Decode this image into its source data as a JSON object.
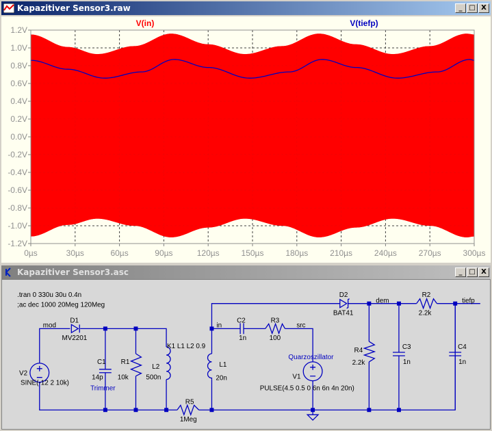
{
  "waveform_window": {
    "title": "Kapazitiver Sensor3.raw",
    "controls": {
      "minimize": "_",
      "maximize": "□",
      "close": "X"
    }
  },
  "schematic_window": {
    "title": "Kapazitiver Sensor3.asc",
    "controls": {
      "minimize": "_",
      "maximize": "□",
      "close": "X"
    }
  },
  "chart_data": {
    "type": "line",
    "xlabel": "",
    "ylabel": "",
    "xlim": [
      0,
      300
    ],
    "ylim": [
      -1.2,
      1.2
    ],
    "x_ticks": [
      "0µs",
      "30µs",
      "60µs",
      "90µs",
      "120µs",
      "150µs",
      "180µs",
      "210µs",
      "240µs",
      "270µs",
      "300µs"
    ],
    "y_ticks": [
      "1.2V",
      "1.0V",
      "0.8V",
      "0.6V",
      "0.4V",
      "0.2V",
      "0.0V",
      "-0.2V",
      "-0.4V",
      "-0.6V",
      "-0.8V",
      "-1.0V",
      "-1.2V"
    ],
    "grid": true,
    "series": [
      {
        "name": "V(in)",
        "color": "#ff0000",
        "style": "filled high-frequency carrier envelope",
        "x": [
          0,
          25,
          45,
          70,
          95,
          120,
          145,
          170,
          195,
          220,
          245,
          270,
          295,
          300
        ],
        "upper": [
          1.15,
          1.01,
          0.93,
          1.02,
          1.16,
          1.04,
          0.93,
          1.02,
          1.16,
          1.04,
          0.93,
          1.02,
          1.16,
          1.15
        ],
        "lower": [
          -1.12,
          -0.99,
          -0.92,
          -1.0,
          -1.13,
          -1.02,
          -0.92,
          -1.0,
          -1.13,
          -1.02,
          -0.92,
          -1.0,
          -1.13,
          -1.12
        ]
      },
      {
        "name": "V(tiefp)",
        "color": "#0000c0",
        "x": [
          0,
          25,
          50,
          75,
          97,
          120,
          148,
          175,
          197,
          220,
          248,
          275,
          297,
          300
        ],
        "values": [
          0.86,
          0.76,
          0.66,
          0.73,
          0.87,
          0.78,
          0.66,
          0.73,
          0.87,
          0.78,
          0.66,
          0.73,
          0.87,
          0.86
        ]
      }
    ]
  },
  "schematic": {
    "directives": [
      ".tran 0 330u 30u 0.4n",
      ";ac dec 1000 20Meg 120Meg"
    ],
    "nets": {
      "mod": "mod",
      "in": "in",
      "src": "src",
      "dem": "dem",
      "tiefp": "tiefp"
    },
    "components": {
      "D1": {
        "name": "D1",
        "value": "MV2201"
      },
      "V2": {
        "name": "V2",
        "value": "SINE(-12 2 10k)"
      },
      "C1": {
        "name": "C1",
        "value": "14p",
        "comment": "Trimmer"
      },
      "R1": {
        "name": "R1",
        "value": "10k"
      },
      "L2": {
        "name": "L2",
        "value": "500n"
      },
      "K1": {
        "text": "K1 L1 L2 0.9"
      },
      "R5": {
        "name": "R5",
        "value": "1Meg"
      },
      "L1": {
        "name": "L1",
        "value": "20n"
      },
      "C2": {
        "name": "C2",
        "value": "1n"
      },
      "R3": {
        "name": "R3",
        "value": "100"
      },
      "V1": {
        "name": "V1",
        "value": "PULSE(4.5 0.5 0 6n 6n 4n 20n)",
        "comment": "Quarzoszillator"
      },
      "D2": {
        "name": "D2",
        "value": "BAT41"
      },
      "R4": {
        "name": "R4",
        "value": "2.2k"
      },
      "C3": {
        "name": "C3",
        "value": "1n"
      },
      "R2": {
        "name": "R2",
        "value": "2.2k"
      },
      "C4": {
        "name": "C4",
        "value": "1n"
      }
    }
  }
}
